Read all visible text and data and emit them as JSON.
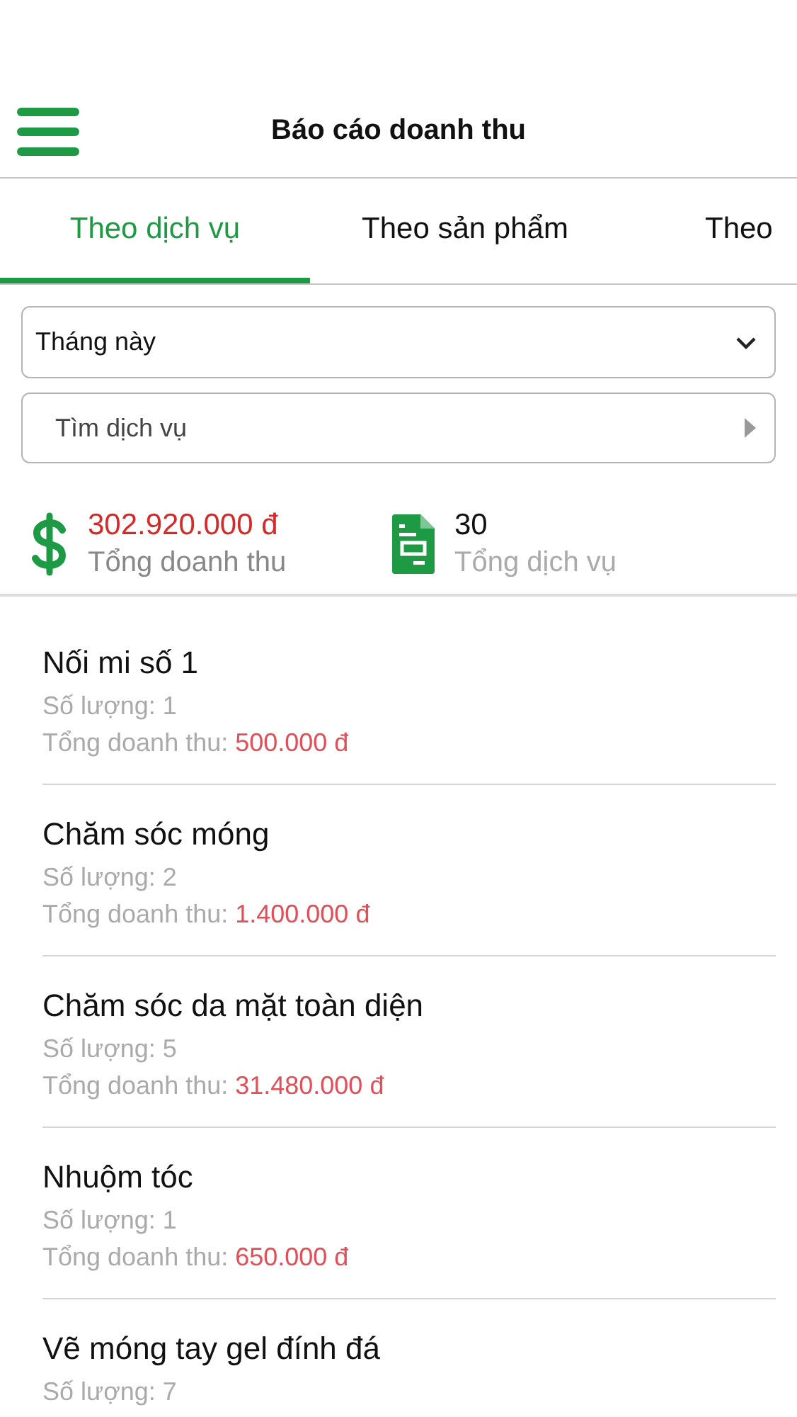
{
  "header": {
    "title": "Báo cáo doanh thu"
  },
  "tabs": [
    {
      "label": "Theo dịch vụ",
      "selected": true
    },
    {
      "label": "Theo sản phẩm",
      "selected": false
    },
    {
      "label": "Theo",
      "selected": false
    }
  ],
  "period_select": {
    "value": "Tháng này"
  },
  "search": {
    "placeholder": "Tìm dịch vụ"
  },
  "summary": [
    {
      "kind": "revenue",
      "value": "302.920.000 đ",
      "label": "Tổng doanh thu"
    },
    {
      "kind": "count",
      "value": "30",
      "label": "Tổng dịch vụ"
    }
  ],
  "services": [
    {
      "name": "Nối mi số 1",
      "quantity": "Số lượng: 1",
      "total_label": "Tổng doanh thu:",
      "total": "500.000 đ"
    },
    {
      "name": "Chăm sóc móng",
      "quantity": "Số lượng: 2",
      "total_label": "Tổng doanh thu:",
      "total": "1.400.000 đ"
    },
    {
      "name": "Chăm sóc da mặt toàn diện",
      "quantity": "Số lượng: 5",
      "total_label": "Tổng doanh thu:",
      "total": "31.480.000 đ"
    },
    {
      "name": "Nhuộm tóc",
      "quantity": "Số lượng: 1",
      "total_label": "Tổng doanh thu:",
      "total": "650.000 đ"
    },
    {
      "name": "Vẽ móng tay gel đính đá",
      "quantity": "Số lượng: 7"
    }
  ]
}
